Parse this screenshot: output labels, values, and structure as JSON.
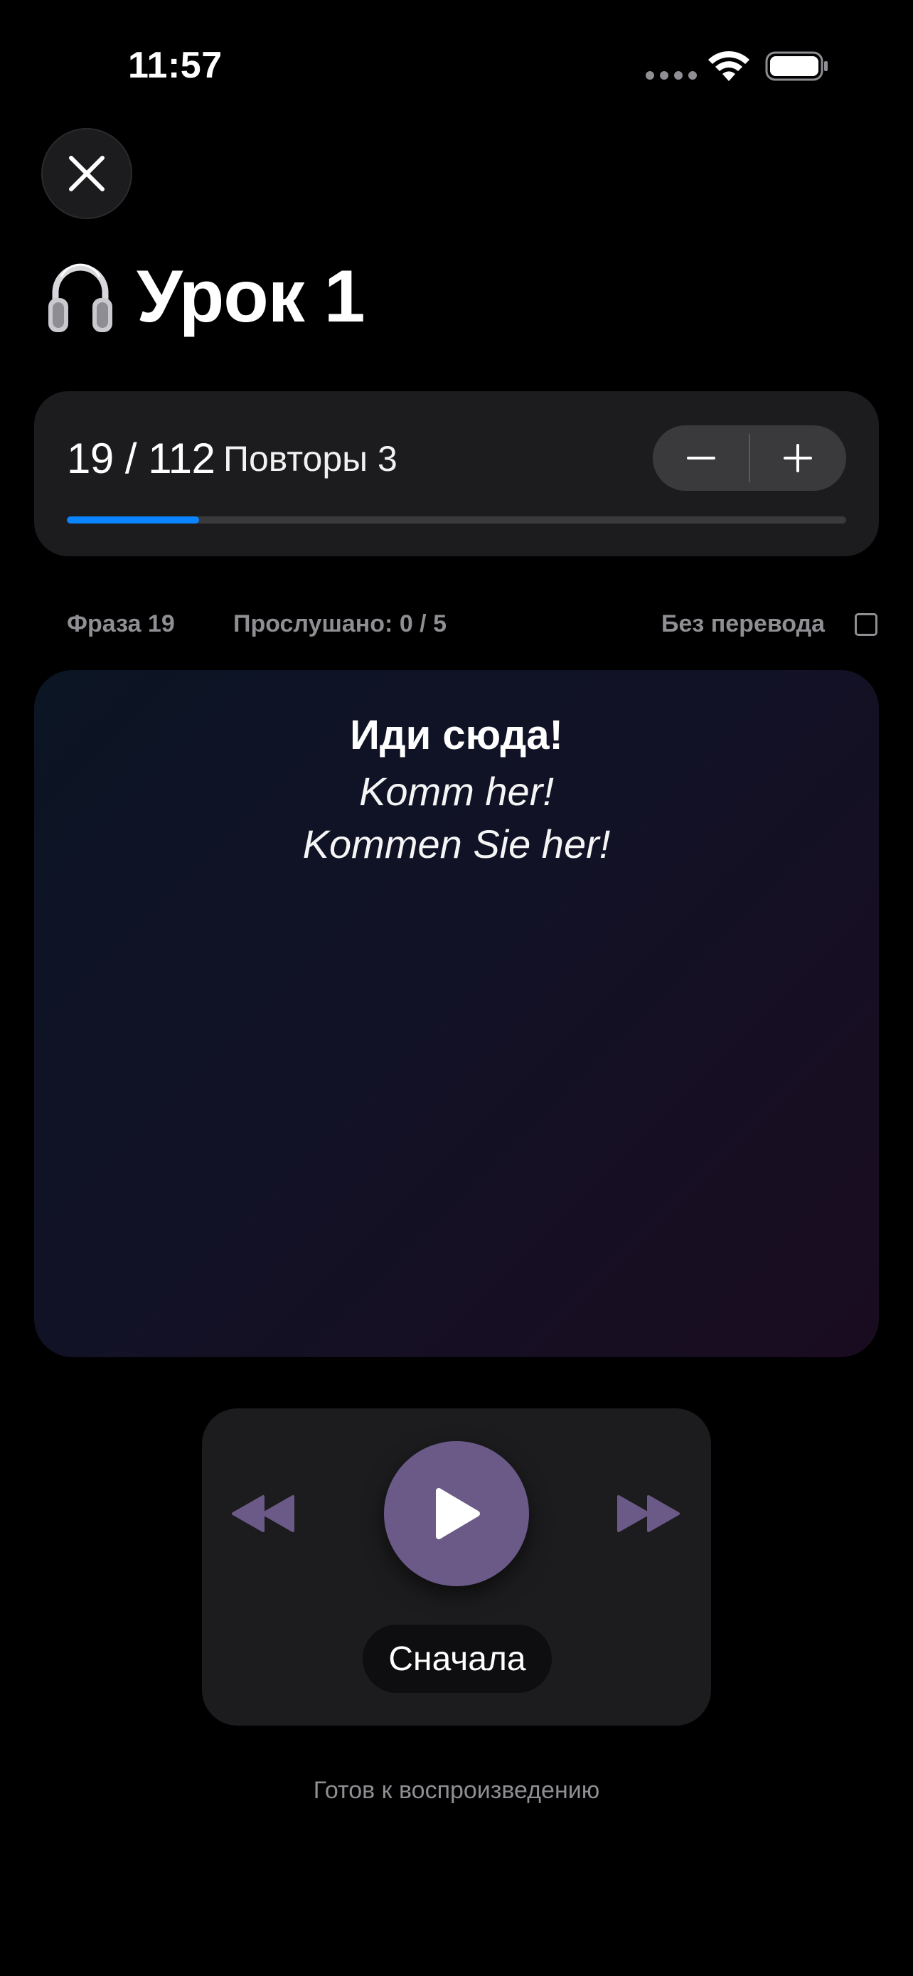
{
  "status_bar": {
    "time": "11:57",
    "wifi_icon": "wifi-icon",
    "battery_icon": "battery-icon"
  },
  "header": {
    "close_icon": "close-icon",
    "lesson_icon": "headphones-icon",
    "title": "Урок 1"
  },
  "progress": {
    "counter": "19 / 112",
    "repeats_label": "Повторы 3",
    "minus_label": "−",
    "plus_label": "+",
    "current": 19,
    "total": 112,
    "fraction": 0.17,
    "accent_color": "#0a84ff"
  },
  "info_row": {
    "phrase_label": "Фраза 19",
    "listened_label": "Прослушано: 0 / 5",
    "no_translation_label": "Без перевода",
    "no_translation_checked": false
  },
  "phrase": {
    "native": "Иди сюда!",
    "translation_informal": "Komm her!",
    "translation_formal": "Kommen Sie her!"
  },
  "player": {
    "rewind_icon": "rewind-icon",
    "play_icon": "play-icon",
    "forward_icon": "fast-forward-icon",
    "restart_label": "Сначала",
    "play_color": "#6b5a88"
  },
  "footer": {
    "status": "Готов к воспроизведению"
  }
}
